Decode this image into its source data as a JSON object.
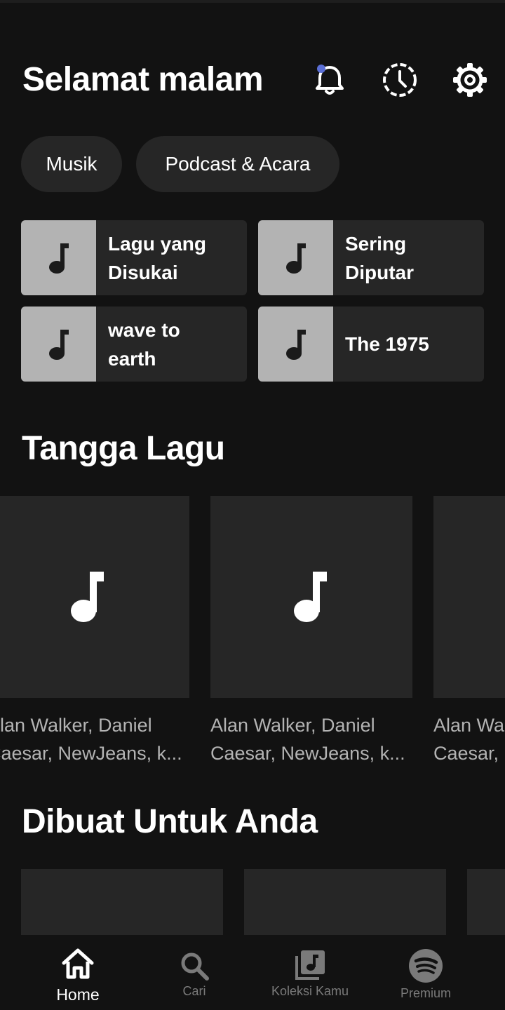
{
  "header": {
    "greeting": "Selamat malam"
  },
  "chips": [
    {
      "label": "Musik"
    },
    {
      "label": "Podcast & Acara"
    }
  ],
  "quick_picks": [
    {
      "line1": "Lagu yang",
      "line2": "Disukai"
    },
    {
      "line1": "Sering",
      "line2": "Diputar"
    },
    {
      "line1": "wave to",
      "line2": "earth"
    },
    {
      "line1": "The 1975",
      "line2": ""
    }
  ],
  "charts_section": {
    "title": "Tangga Lagu",
    "cards": [
      {
        "line1": "Alan Walker, Daniel",
        "line2": "Caesar, NewJeans, k..."
      },
      {
        "line1": "Alan Walker, Daniel",
        "line2": "Caesar, NewJeans, k..."
      },
      {
        "line1": "Alan Walker, Daniel",
        "line2": "Caesar, NewJeans, k..."
      }
    ]
  },
  "made_for_you": {
    "title": "Dibuat Untuk Anda"
  },
  "bottom_nav": {
    "items": [
      {
        "label": "Home",
        "icon": "home-icon",
        "active": true
      },
      {
        "label": "Cari",
        "icon": "search-icon",
        "active": false
      },
      {
        "label": "Koleksi Kamu",
        "icon": "library-icon",
        "active": false
      },
      {
        "label": "Premium",
        "icon": "spotify-icon",
        "active": false
      }
    ]
  },
  "colors": {
    "background": "#121212",
    "card": "#262626",
    "thumb": "#b3b3b3",
    "notification_dot": "#5b6fd6",
    "muted_text": "#b3b3b3",
    "inactive_nav": "#7a7a7a"
  }
}
